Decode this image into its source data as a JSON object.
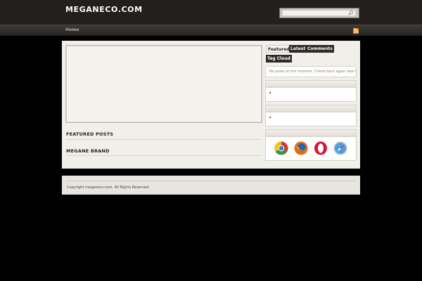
{
  "header": {
    "site_title": "MEGANECO.COM",
    "search_value": ""
  },
  "nav": {
    "items": [
      {
        "label": "Home"
      }
    ]
  },
  "main": {
    "sections": [
      {
        "title": "FEATURED POSTS"
      },
      {
        "title": "MEGANE BRAND"
      }
    ]
  },
  "sidebar": {
    "tabs": [
      {
        "label": "Featured",
        "active": true
      },
      {
        "label": "Latest",
        "active": false
      },
      {
        "label": "Comments",
        "active": false
      },
      {
        "label": "Tag Cloud",
        "active": false
      }
    ],
    "no_posts_text": "No posts at the moment. Check back again later!",
    "browsers": [
      "chrome-icon",
      "firefox-icon",
      "opera-icon",
      "safari-icon"
    ]
  },
  "footer": {
    "copyright": "Copyright meganeco.com. All Rights Reserved."
  },
  "colors": {
    "background": "#000000",
    "header": "#221f1d",
    "content": "#f1efea",
    "rss": "#f08a24"
  }
}
